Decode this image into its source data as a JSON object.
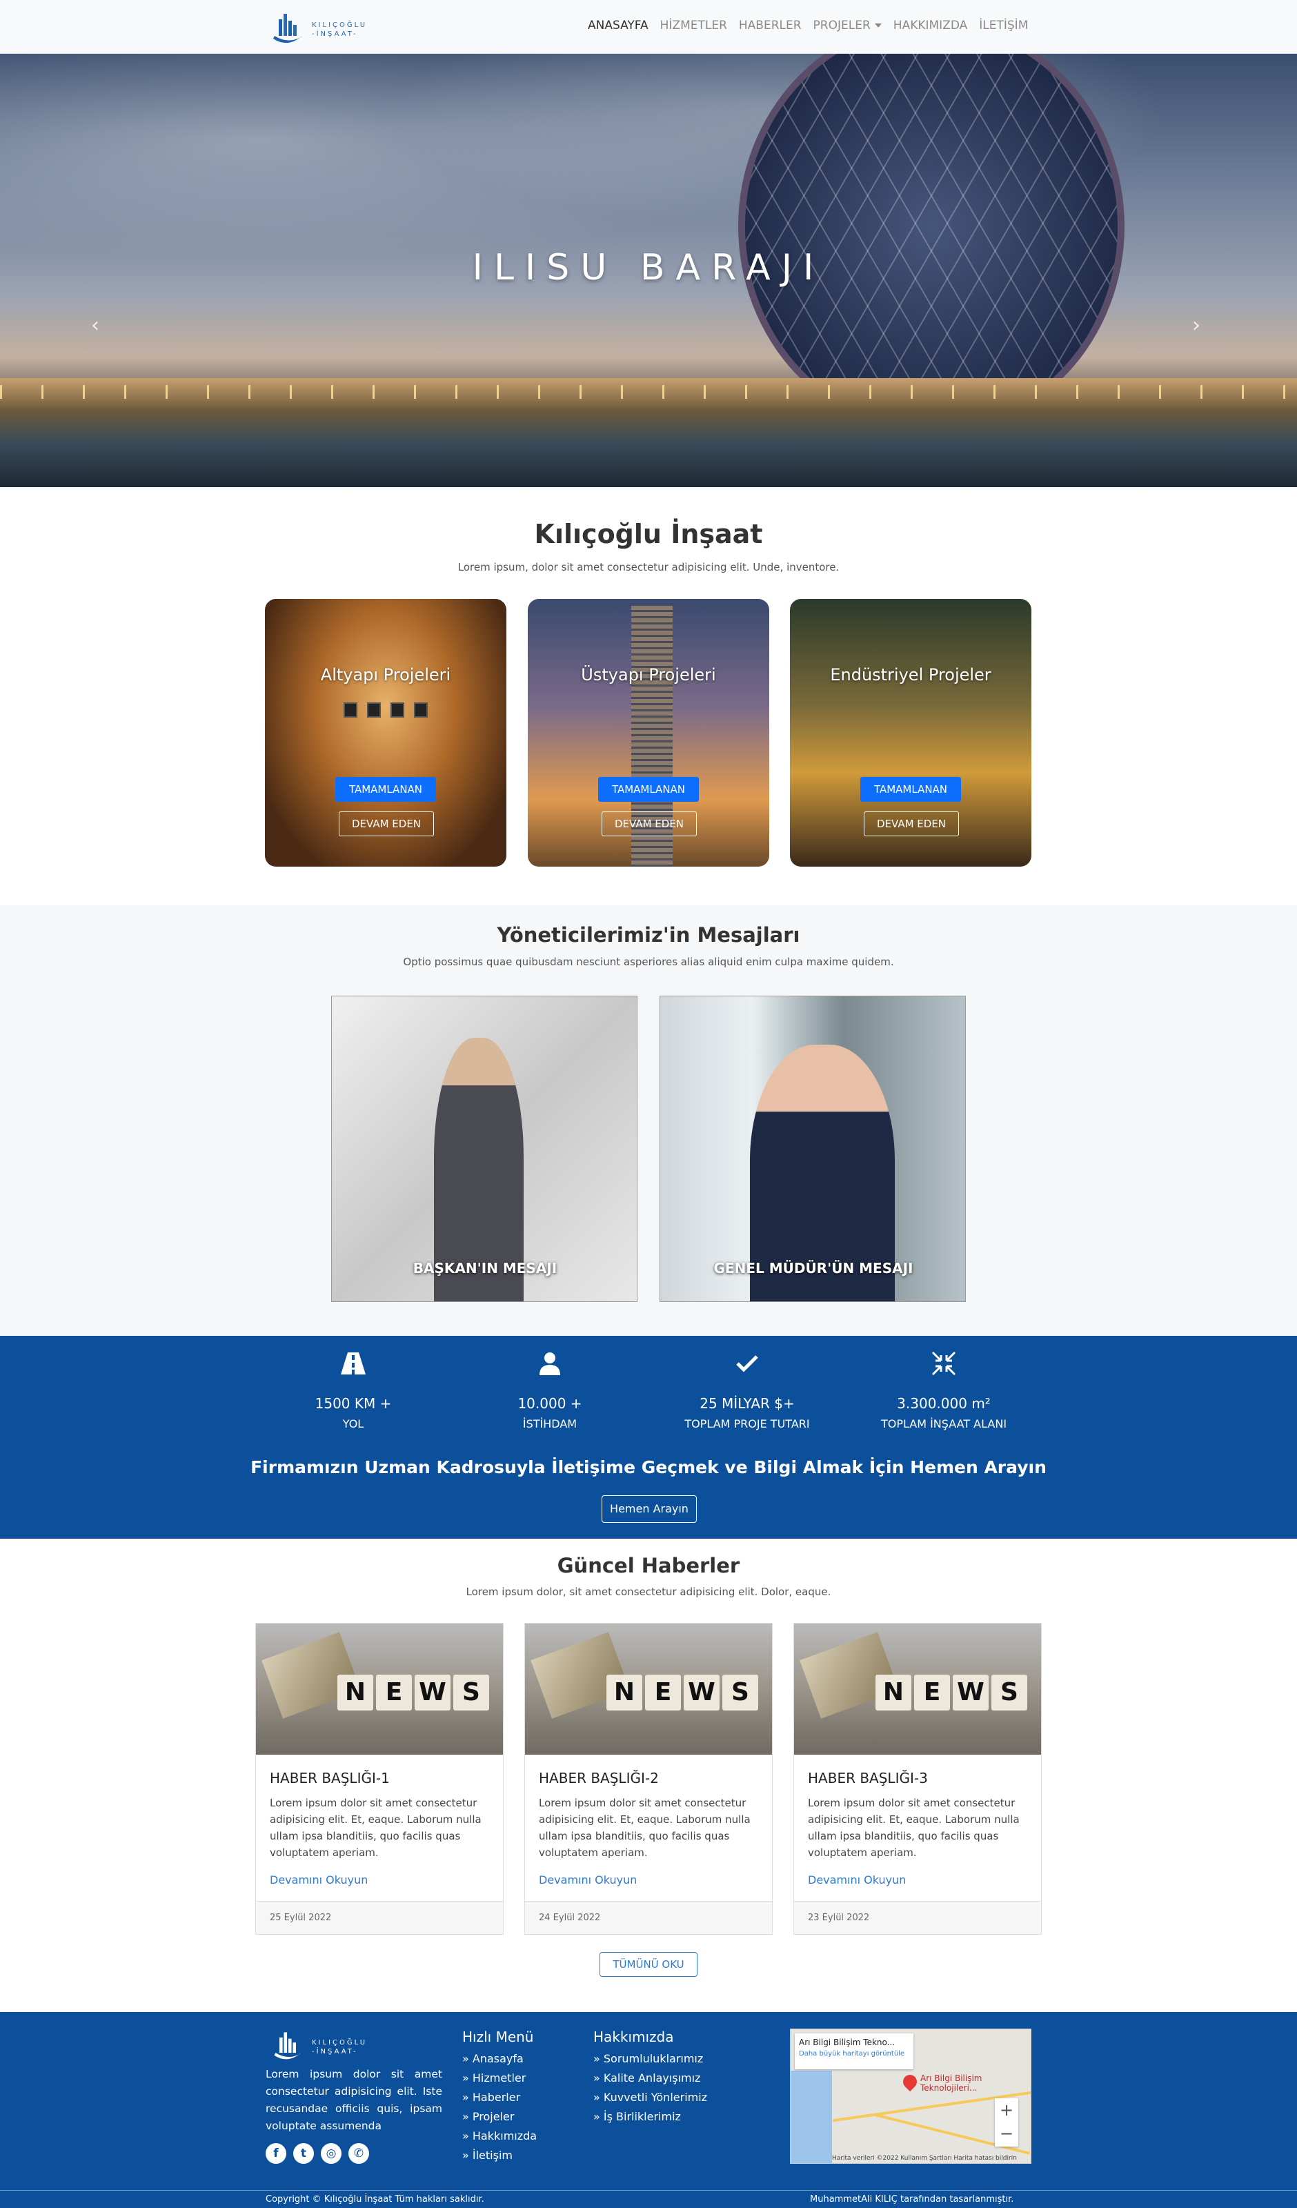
{
  "nav": {
    "brand_line1": "KILIÇOĞLU",
    "brand_line2": "-İNŞAAT-",
    "items": [
      "ANASAYFA",
      "HİZMETLER",
      "HABERLER",
      "PROJELER",
      "HAKKIMIZDA",
      "İLETİŞİM"
    ],
    "active": "ANASAYFA"
  },
  "hero": {
    "title": "ILISU BARAJI",
    "prev_glyph": "‹",
    "next_glyph": "›",
    "slides": 3,
    "active_slide": 2
  },
  "company": {
    "title": "Kılıçoğlu İnşaat",
    "subtitle": "Lorem ipsum, dolor sit amet consectetur adipisicing elit. Unde, inventore.",
    "cards": [
      {
        "title": "Altyapı Projeleri",
        "btn_primary": "TAMAMLANAN",
        "btn_secondary": "DEVAM EDEN"
      },
      {
        "title": "Üstyapı Projeleri",
        "btn_primary": "TAMAMLANAN",
        "btn_secondary": "DEVAM EDEN"
      },
      {
        "title": "Endüstriyel Projeler",
        "btn_primary": "TAMAMLANAN",
        "btn_secondary": "DEVAM EDEN"
      }
    ]
  },
  "managers": {
    "title": "Yöneticilerimiz'in Mesajları",
    "subtitle": "Optio possimus quae quibusdam nesciunt asperiores alias aliquid enim culpa maxime quidem.",
    "items": [
      {
        "caption": "BAŞKAN'IN MESAJI"
      },
      {
        "caption": "GENEL MÜDÜR'ÜN MESAJI"
      }
    ]
  },
  "stats": {
    "items": [
      {
        "icon": "road-icon",
        "value": "1500 KM +",
        "label": "YOL"
      },
      {
        "icon": "user-icon",
        "value": "10.000 +",
        "label": "İSTİHDAM"
      },
      {
        "icon": "check-icon",
        "value": "25 MİLYAR $+",
        "label": "TOPLAM PROJE TUTARI"
      },
      {
        "icon": "compress-arrows-icon",
        "value": "3.300.000 m²",
        "label": "TOPLAM İNŞAAT ALANI"
      }
    ],
    "cta": "Firmamızın Uzman Kadrosuyla İletişime Geçmek ve Bilgi Almak İçin Hemen Arayın",
    "call_button": "Hemen Arayın"
  },
  "news": {
    "title": "Güncel Haberler",
    "subtitle": "Lorem ipsum dolor, sit amet consectetur adipisicing elit. Dolor, eaque.",
    "image_word": [
      "N",
      "E",
      "W",
      "S"
    ],
    "items": [
      {
        "title": "HABER BAŞLIĞI-1",
        "text": "Lorem ipsum dolor sit amet consectetur adipisicing elit. Et, eaque. Laborum nulla ullam ipsa blanditiis, quo facilis quas voluptatem aperiam.",
        "link": "Devamını Okuyun",
        "date": "25 Eylül 2022"
      },
      {
        "title": "HABER BAŞLIĞI-2",
        "text": "Lorem ipsum dolor sit amet consectetur adipisicing elit. Et, eaque. Laborum nulla ullam ipsa blanditiis, quo facilis quas voluptatem aperiam.",
        "link": "Devamını Okuyun",
        "date": "24 Eylül 2022"
      },
      {
        "title": "HABER BAŞLIĞI-3",
        "text": "Lorem ipsum dolor sit amet consectetur adipisicing elit. Et, eaque. Laborum nulla ullam ipsa blanditiis, quo facilis quas voluptatem aperiam.",
        "link": "Devamını Okuyun",
        "date": "23 Eylül 2022"
      }
    ],
    "all_button": "TÜMÜNÜ OKU"
  },
  "footer": {
    "about": "Lorem ipsum dolor sit amet consectetur adipisicing elit. Iste recusandae officiis quis, ipsam voluptate assumenda",
    "social": [
      {
        "icon": "facebook-icon",
        "glyph": "f"
      },
      {
        "icon": "twitter-icon",
        "glyph": "t"
      },
      {
        "icon": "instagram-icon",
        "glyph": "◎"
      },
      {
        "icon": "whatsapp-icon",
        "glyph": "✆"
      }
    ],
    "quick_menu": {
      "title": "Hızlı Menü",
      "items": [
        "» Anasayfa",
        "» Hizmetler",
        "» Haberler",
        "» Projeler",
        "» Hakkımızda",
        "» İletişim"
      ]
    },
    "about_menu": {
      "title": "Hakkımızda",
      "items": [
        "» Sorumluluklarımız",
        "» Kalite Anlayışımız",
        "» Kuvvetli Yönlerimiz",
        "» İş Birliklerimiz"
      ]
    },
    "map": {
      "place": "Arı Bilgi Bilişim Tekno...",
      "larger_map": "Daha büyük haritayı görüntüle",
      "pin_label": "Arı Bilgi Bilişim Teknolojileri...",
      "attribution": "Harita verileri ©2022   Kullanım Şartları   Harita hatası bildirin"
    },
    "copyright": "Copyright © Kılıçoğlu İnşaat Tüm hakları saklıdır.",
    "designer": "MuhammetAli KILIÇ tarafından tasarlanmıştır.",
    "colors": {
      "primary": "#0c4f9b",
      "accent": "#0d6efd"
    }
  }
}
